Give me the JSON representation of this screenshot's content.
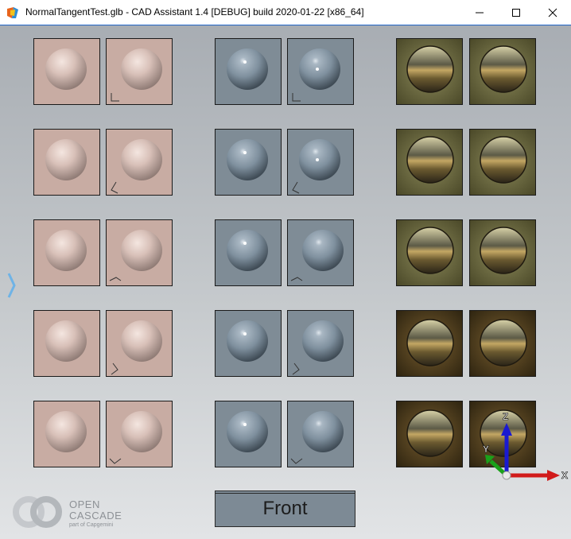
{
  "window": {
    "title": "NormalTangentTest.glb - CAD Assistant 1.4 [DEBUG] build 2020-01-22 [x86_64]",
    "minimize_icon": "minimize-icon",
    "maximize_icon": "maximize-icon",
    "close_icon": "close-icon"
  },
  "viewport": {
    "view_button_label": "Front",
    "logo": {
      "line1": "OPEN",
      "line2": "CASCADE",
      "line3": "part of Capgemini"
    },
    "axes": {
      "x": "X",
      "y": "Y",
      "z": "Z"
    }
  },
  "colors": {
    "pink_tile": "#c8aca3",
    "blue_tile": "#7f8c96",
    "env_tile": "#6e6a3c",
    "axis_x": "#d11a1a",
    "axis_y": "#1aa11a",
    "axis_z": "#1a1ad1",
    "title_accent": "#1f64c8"
  }
}
